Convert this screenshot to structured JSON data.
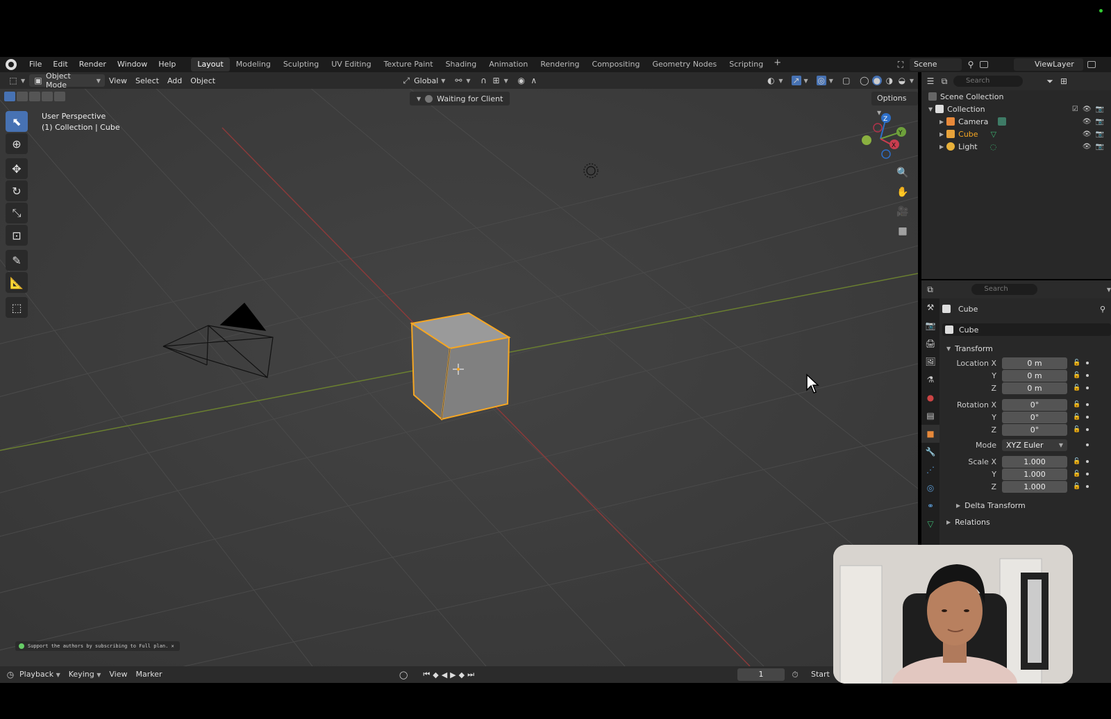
{
  "menubar": {
    "items": [
      "File",
      "Edit",
      "Render",
      "Window",
      "Help"
    ],
    "workspaces": [
      "Layout",
      "Modeling",
      "Sculpting",
      "UV Editing",
      "Texture Paint",
      "Shading",
      "Animation",
      "Rendering",
      "Compositing",
      "Geometry Nodes",
      "Scripting"
    ],
    "active_workspace": "Layout",
    "scene": "Scene",
    "view_layer": "ViewLayer"
  },
  "viewport_header": {
    "mode": "Object Mode",
    "menus": [
      "View",
      "Select",
      "Add",
      "Object"
    ],
    "orientation": "Global",
    "status": "Waiting for Client",
    "options": "Options"
  },
  "viewport": {
    "perspective": "User Perspective",
    "collection_label": "(1) Collection | Cube",
    "notice": "Support the authors by subscribing to Full plan.",
    "gizmo": {
      "z": "Z",
      "y": "Y",
      "x": "X"
    }
  },
  "timeline": {
    "menus": [
      "Playback",
      "Keying",
      "View",
      "Marker"
    ],
    "frame": "1",
    "start_label": "Start"
  },
  "outliner": {
    "search_placeholder": "Search",
    "scene_collection": "Scene Collection",
    "collection": "Collection",
    "objects": [
      {
        "name": "Camera",
        "color": "#e8893a"
      },
      {
        "name": "Cube",
        "color": "#e8a33a"
      },
      {
        "name": "Light",
        "color": "#e8b13a"
      }
    ]
  },
  "properties": {
    "search_placeholder": "Search",
    "object_title": "Cube",
    "object_name": "Cube",
    "transform_label": "Transform",
    "location": {
      "label": "Location X",
      "x": "0 m",
      "y": "0 m",
      "z": "0 m"
    },
    "rotation": {
      "label": "Rotation X",
      "x": "0°",
      "y": "0°",
      "z": "0°"
    },
    "mode_label": "Mode",
    "mode_value": "XYZ Euler",
    "scale": {
      "label": "Scale X",
      "x": "1.000",
      "y": "1.000",
      "z": "1.000"
    },
    "axis_y": "Y",
    "axis_z": "Z",
    "delta_transform": "Delta Transform",
    "relations": "Relations"
  },
  "colors": {
    "accent": "#4772b3",
    "selection": "#f5a623",
    "x_axis": "#b33c3c",
    "y_axis": "#6e8c2e"
  }
}
